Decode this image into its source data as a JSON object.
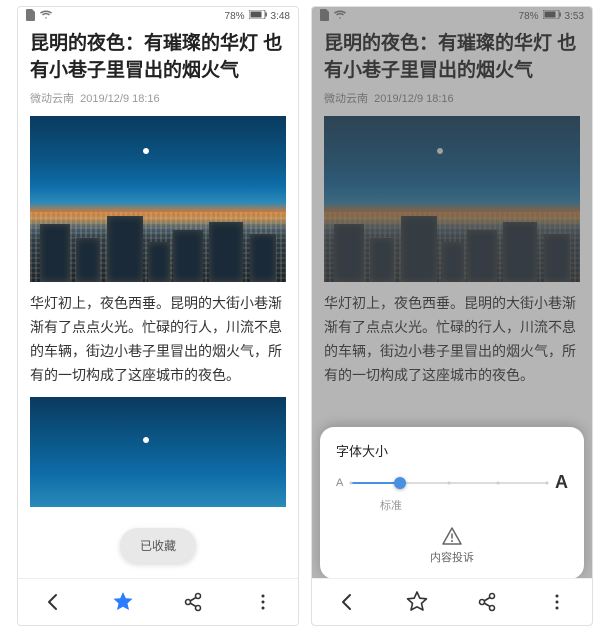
{
  "status": {
    "doc": "📄",
    "wifi": "🛜",
    "battery_pct": "78%",
    "time_left": "3:48",
    "time_right": "3:53"
  },
  "article": {
    "title": "昆明的夜色：有璀璨的华灯 也有小巷子里冒出的烟火气",
    "source": "微动云南",
    "date": "2019/12/9  18:16",
    "body": "华灯初上，夜色西垂。昆明的大街小巷渐渐有了点点火光。忙碌的行人，川流不息的车辆，街边小巷子里冒出的烟火气，所有的一切构成了这座城市的夜色。",
    "body_truncated": "华灯初上，夜色西垂。昆明的大街小巷渐渐有了点点火光。忙碌的行人，川流不息的车辆，街边小巷子里冒出的烟火气，所有的一切构成了这座城市的夜色。"
  },
  "toast": {
    "text": "已收藏"
  },
  "sheet": {
    "title": "字体大小",
    "current_label": "标准",
    "report": "内容投诉"
  }
}
